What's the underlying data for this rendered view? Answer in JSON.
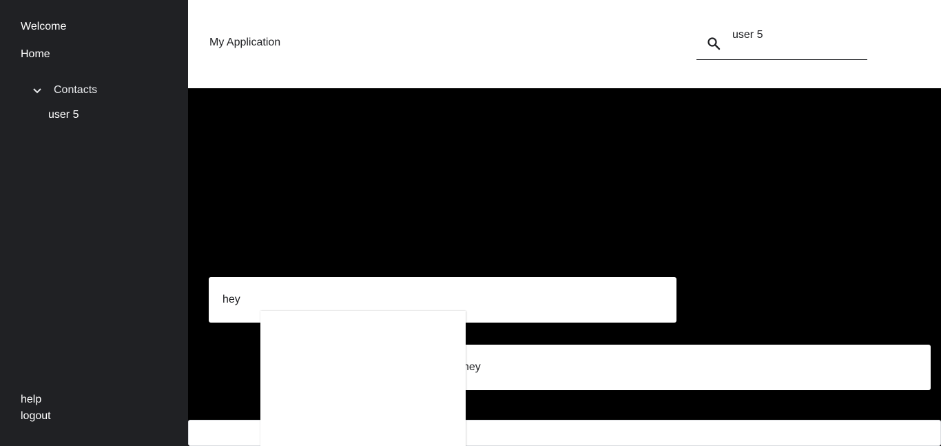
{
  "sidebar": {
    "welcome": "Welcome",
    "home": "Home",
    "contacts": {
      "label": "Contacts",
      "icon": "chevron-down-icon",
      "items": [
        {
          "label": "user 5"
        }
      ]
    },
    "help": "help",
    "logout": "logout",
    "background": "#202124"
  },
  "header": {
    "title": "My Application",
    "search": {
      "icon": "search-icon",
      "value": "user 5"
    }
  },
  "chat": {
    "background": "#000000",
    "messages": [
      {
        "text": "hey",
        "side": "left"
      },
      {
        "text": "hey",
        "side": "right"
      }
    ],
    "composer": {
      "value": ""
    }
  }
}
